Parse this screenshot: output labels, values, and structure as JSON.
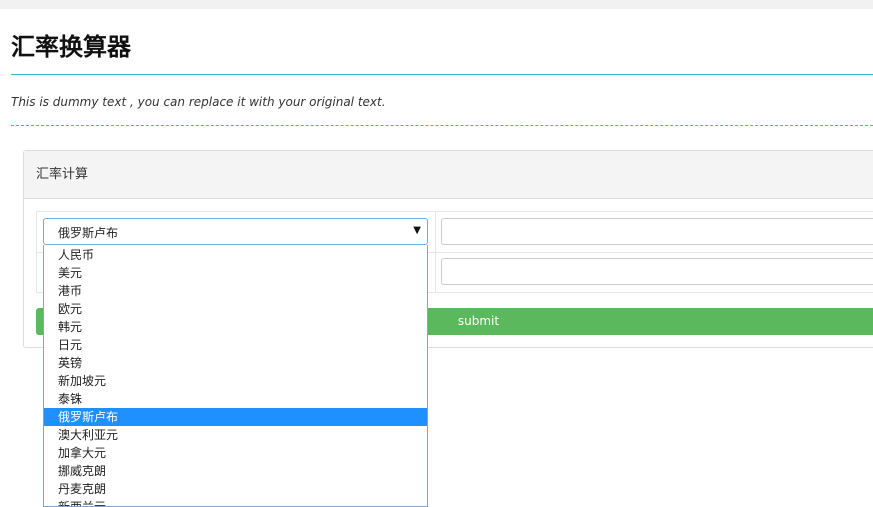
{
  "page": {
    "title": "汇率换算器",
    "subtitle": "This is dummy text , you can replace it with your original text."
  },
  "panel": {
    "title": "汇率计算",
    "select": {
      "value": "俄罗斯卢布",
      "arrow_icon": "dropdown-arrow-icon"
    },
    "input_1": {
      "value": "",
      "placeholder": ""
    },
    "input_2": {
      "value": "",
      "placeholder": ""
    },
    "submit_label": "submit"
  },
  "dropdown": {
    "options": [
      {
        "label": "人民币"
      },
      {
        "label": "美元"
      },
      {
        "label": "港币"
      },
      {
        "label": "欧元"
      },
      {
        "label": "韩元"
      },
      {
        "label": "日元"
      },
      {
        "label": "英镑"
      },
      {
        "label": "新加坡元"
      },
      {
        "label": "泰铢"
      },
      {
        "label": "俄罗斯卢布",
        "selected": true
      },
      {
        "label": "澳大利亚元"
      },
      {
        "label": "加拿大元"
      },
      {
        "label": "挪威克朗"
      },
      {
        "label": "丹麦克朗"
      },
      {
        "label": "新西兰元"
      }
    ]
  },
  "colors": {
    "accent_rule": "#3bb3d1",
    "submit_green": "#5cb85c",
    "option_highlight": "#1e90ff"
  }
}
